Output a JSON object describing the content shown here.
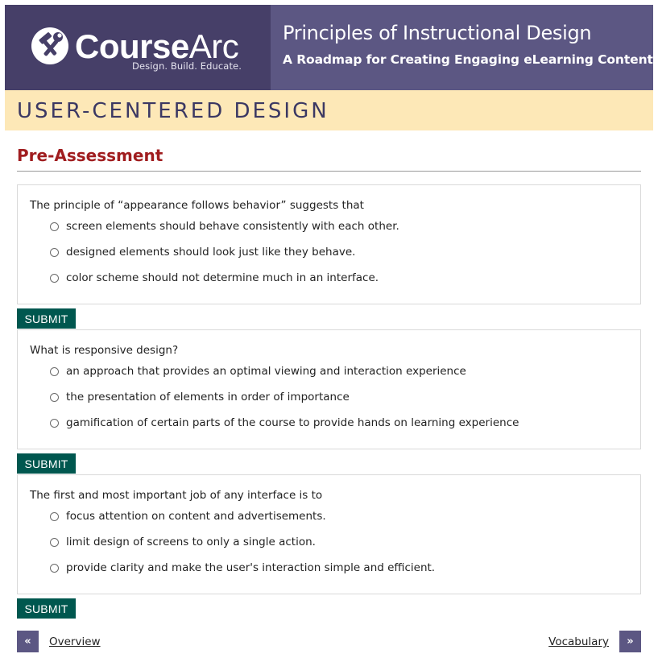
{
  "header": {
    "logo_bold": "Course",
    "logo_light": "Arc",
    "tagline": "Design. Build. Educate.",
    "course_title": "Principles of Instructional Design",
    "course_subtitle": "A Roadmap for Creating Engaging eLearning Content"
  },
  "section": {
    "title": "USER-CENTERED DESIGN"
  },
  "page": {
    "heading": "Pre-Assessment"
  },
  "questions": [
    {
      "text": "The principle of “appearance follows behavior” suggests that",
      "options": [
        "screen elements should behave consistently with each other.",
        "designed elements should look just like they behave.",
        "color scheme should not determine much in an interface."
      ],
      "submit_label": "SUBMIT"
    },
    {
      "text": "What is responsive design?",
      "options": [
        "an approach that provides an optimal viewing and interaction experience",
        "the presentation of elements in order of importance",
        "gamification of certain parts of the course to provide hands on learning experience"
      ],
      "submit_label": "SUBMIT"
    },
    {
      "text": "The first and most important job of any interface is to",
      "options": [
        "focus attention on content and advertisements.",
        "limit design of screens to only a single action.",
        "provide clarity and make the user's interaction simple and efficient."
      ],
      "submit_label": "SUBMIT"
    }
  ],
  "nav": {
    "prev_icon": "«",
    "prev_label": "Overview",
    "next_label": "Vocabulary",
    "next_icon": "»"
  },
  "colors": {
    "brand_dark": "#463f68",
    "brand_mid": "#5c5783",
    "section_band": "#fde8b7",
    "heading_red": "#a01d1f",
    "submit_green": "#00574f"
  }
}
